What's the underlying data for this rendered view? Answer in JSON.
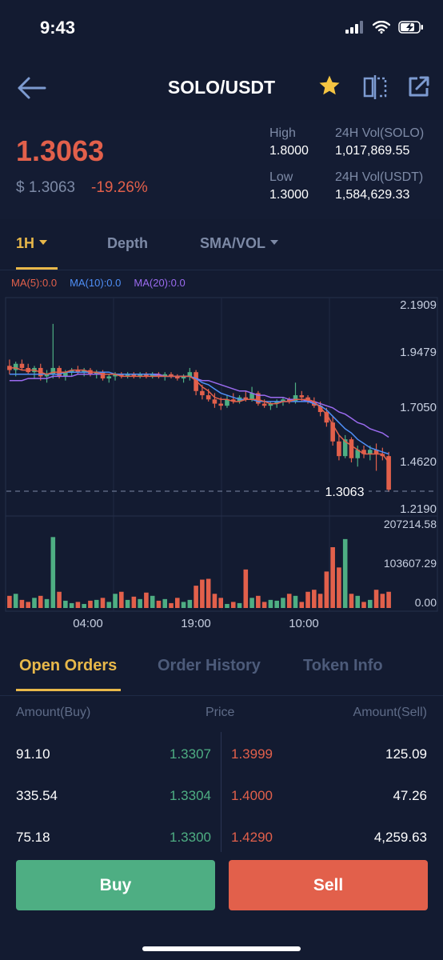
{
  "status_bar": {
    "time": "9:43"
  },
  "header": {
    "pair": "SOLO/USDT"
  },
  "price": {
    "last": "1.3063",
    "usd": "$ 1.3063",
    "change": "-19.26%",
    "high_label": "High",
    "high_value": "1.8000",
    "low_label": "Low",
    "low_value": "1.3000",
    "vol_base_label": "24H Vol(SOLO)",
    "vol_base_value": "1,017,869.55",
    "vol_quote_label": "24H Vol(USDT)",
    "vol_quote_value": "1,584,629.33"
  },
  "chart_tabs": {
    "interval": "1H",
    "depth": "Depth",
    "indicator": "SMA/VOL"
  },
  "ma_legend": {
    "ma5": "MA(5):0.0",
    "ma10": "MA(10):0.0",
    "ma20": "MA(20):0.0"
  },
  "colors": {
    "up": "#4eae83",
    "down": "#e2604b",
    "accent": "#e8b84a",
    "ma5": "#e2604b",
    "ma10": "#4f8ff7",
    "ma20": "#9b6bf0",
    "background": "#131b31"
  },
  "chart": {
    "price_ticks": [
      "2.1909",
      "1.9479",
      "1.7050",
      "1.4620",
      "1.2190"
    ],
    "volume_ticks": [
      "207214.58",
      "103607.29",
      "0.00"
    ],
    "time_ticks": [
      "04:00",
      "19:00",
      "10:00"
    ],
    "last_price_marker": "1.3063"
  },
  "chart_data": {
    "type": "candlestick",
    "ylim": [
      1.219,
      2.1909
    ],
    "volume_ylim": [
      0,
      207214.58
    ],
    "candles": [
      {
        "o": 1.9,
        "h": 1.93,
        "l": 1.86,
        "c": 1.88,
        "v": 30000
      },
      {
        "o": 1.88,
        "h": 1.92,
        "l": 1.85,
        "c": 1.91,
        "v": 35000
      },
      {
        "o": 1.91,
        "h": 1.93,
        "l": 1.88,
        "c": 1.89,
        "v": 20000
      },
      {
        "o": 1.89,
        "h": 1.91,
        "l": 1.86,
        "c": 1.87,
        "v": 15000
      },
      {
        "o": 1.87,
        "h": 1.9,
        "l": 1.84,
        "c": 1.89,
        "v": 25000
      },
      {
        "o": 1.89,
        "h": 1.91,
        "l": 1.83,
        "c": 1.85,
        "v": 30000
      },
      {
        "o": 1.85,
        "h": 1.88,
        "l": 1.82,
        "c": 1.86,
        "v": 22000
      },
      {
        "o": 1.86,
        "h": 2.1,
        "l": 1.84,
        "c": 1.89,
        "v": 175000
      },
      {
        "o": 1.89,
        "h": 1.9,
        "l": 1.84,
        "c": 1.85,
        "v": 40000
      },
      {
        "o": 1.85,
        "h": 1.88,
        "l": 1.83,
        "c": 1.87,
        "v": 18000
      },
      {
        "o": 1.87,
        "h": 1.89,
        "l": 1.85,
        "c": 1.88,
        "v": 12000
      },
      {
        "o": 1.88,
        "h": 1.9,
        "l": 1.86,
        "c": 1.87,
        "v": 15000
      },
      {
        "o": 1.87,
        "h": 1.89,
        "l": 1.85,
        "c": 1.88,
        "v": 10000
      },
      {
        "o": 1.88,
        "h": 1.89,
        "l": 1.85,
        "c": 1.86,
        "v": 18000
      },
      {
        "o": 1.86,
        "h": 1.88,
        "l": 1.84,
        "c": 1.87,
        "v": 20000
      },
      {
        "o": 1.87,
        "h": 1.88,
        "l": 1.83,
        "c": 1.84,
        "v": 25000
      },
      {
        "o": 1.84,
        "h": 1.86,
        "l": 1.82,
        "c": 1.85,
        "v": 15000
      },
      {
        "o": 1.85,
        "h": 1.87,
        "l": 1.83,
        "c": 1.86,
        "v": 35000
      },
      {
        "o": 1.86,
        "h": 1.87,
        "l": 1.84,
        "c": 1.85,
        "v": 40000
      },
      {
        "o": 1.85,
        "h": 1.87,
        "l": 1.84,
        "c": 1.86,
        "v": 20000
      },
      {
        "o": 1.86,
        "h": 1.87,
        "l": 1.84,
        "c": 1.85,
        "v": 28000
      },
      {
        "o": 1.85,
        "h": 1.87,
        "l": 1.84,
        "c": 1.86,
        "v": 22000
      },
      {
        "o": 1.86,
        "h": 1.87,
        "l": 1.84,
        "c": 1.85,
        "v": 38000
      },
      {
        "o": 1.85,
        "h": 1.87,
        "l": 1.84,
        "c": 1.86,
        "v": 30000
      },
      {
        "o": 1.86,
        "h": 1.87,
        "l": 1.84,
        "c": 1.85,
        "v": 18000
      },
      {
        "o": 1.85,
        "h": 1.87,
        "l": 1.83,
        "c": 1.86,
        "v": 22000
      },
      {
        "o": 1.86,
        "h": 1.87,
        "l": 1.84,
        "c": 1.85,
        "v": 12000
      },
      {
        "o": 1.85,
        "h": 1.86,
        "l": 1.83,
        "c": 1.84,
        "v": 25000
      },
      {
        "o": 1.84,
        "h": 1.86,
        "l": 1.82,
        "c": 1.85,
        "v": 15000
      },
      {
        "o": 1.85,
        "h": 1.89,
        "l": 1.83,
        "c": 1.87,
        "v": 20000
      },
      {
        "o": 1.87,
        "h": 1.88,
        "l": 1.76,
        "c": 1.78,
        "v": 55000
      },
      {
        "o": 1.78,
        "h": 1.81,
        "l": 1.74,
        "c": 1.76,
        "v": 70000
      },
      {
        "o": 1.76,
        "h": 1.79,
        "l": 1.73,
        "c": 1.74,
        "v": 72000
      },
      {
        "o": 1.74,
        "h": 1.77,
        "l": 1.7,
        "c": 1.72,
        "v": 35000
      },
      {
        "o": 1.72,
        "h": 1.75,
        "l": 1.69,
        "c": 1.71,
        "v": 25000
      },
      {
        "o": 1.71,
        "h": 1.76,
        "l": 1.7,
        "c": 1.74,
        "v": 10000
      },
      {
        "o": 1.74,
        "h": 1.77,
        "l": 1.72,
        "c": 1.73,
        "v": 15000
      },
      {
        "o": 1.73,
        "h": 1.76,
        "l": 1.72,
        "c": 1.75,
        "v": 12000
      },
      {
        "o": 1.75,
        "h": 1.78,
        "l": 1.73,
        "c": 1.74,
        "v": 95000
      },
      {
        "o": 1.74,
        "h": 1.8,
        "l": 1.73,
        "c": 1.77,
        "v": 25000
      },
      {
        "o": 1.77,
        "h": 1.78,
        "l": 1.71,
        "c": 1.72,
        "v": 30000
      },
      {
        "o": 1.72,
        "h": 1.74,
        "l": 1.7,
        "c": 1.71,
        "v": 15000
      },
      {
        "o": 1.71,
        "h": 1.73,
        "l": 1.69,
        "c": 1.72,
        "v": 20000
      },
      {
        "o": 1.72,
        "h": 1.74,
        "l": 1.7,
        "c": 1.73,
        "v": 18000
      },
      {
        "o": 1.73,
        "h": 1.75,
        "l": 1.71,
        "c": 1.74,
        "v": 25000
      },
      {
        "o": 1.74,
        "h": 1.75,
        "l": 1.72,
        "c": 1.73,
        "v": 35000
      },
      {
        "o": 1.73,
        "h": 1.82,
        "l": 1.72,
        "c": 1.76,
        "v": 30000
      },
      {
        "o": 1.76,
        "h": 1.78,
        "l": 1.73,
        "c": 1.75,
        "v": 15000
      },
      {
        "o": 1.75,
        "h": 1.76,
        "l": 1.72,
        "c": 1.73,
        "v": 40000
      },
      {
        "o": 1.73,
        "h": 1.75,
        "l": 1.7,
        "c": 1.71,
        "v": 45000
      },
      {
        "o": 1.71,
        "h": 1.73,
        "l": 1.66,
        "c": 1.68,
        "v": 35000
      },
      {
        "o": 1.68,
        "h": 1.7,
        "l": 1.61,
        "c": 1.63,
        "v": 90000
      },
      {
        "o": 1.63,
        "h": 1.66,
        "l": 1.52,
        "c": 1.54,
        "v": 150000
      },
      {
        "o": 1.54,
        "h": 1.57,
        "l": 1.45,
        "c": 1.47,
        "v": 100000
      },
      {
        "o": 1.47,
        "h": 1.57,
        "l": 1.46,
        "c": 1.55,
        "v": 170000
      },
      {
        "o": 1.55,
        "h": 1.56,
        "l": 1.44,
        "c": 1.46,
        "v": 35000
      },
      {
        "o": 1.46,
        "h": 1.52,
        "l": 1.42,
        "c": 1.5,
        "v": 30000
      },
      {
        "o": 1.5,
        "h": 1.52,
        "l": 1.46,
        "c": 1.48,
        "v": 15000
      },
      {
        "o": 1.48,
        "h": 1.52,
        "l": 1.45,
        "c": 1.5,
        "v": 20000
      },
      {
        "o": 1.5,
        "h": 1.53,
        "l": 1.4,
        "c": 1.48,
        "v": 45000
      },
      {
        "o": 1.48,
        "h": 1.51,
        "l": 1.45,
        "c": 1.47,
        "v": 35000
      },
      {
        "o": 1.47,
        "h": 1.49,
        "l": 1.3,
        "c": 1.31,
        "v": 40000
      }
    ],
    "ma5": [
      1.89,
      1.89,
      1.88,
      1.88,
      1.88,
      1.87,
      1.86,
      1.87,
      1.87,
      1.87,
      1.88,
      1.88,
      1.88,
      1.87,
      1.87,
      1.86,
      1.86,
      1.86,
      1.85,
      1.85,
      1.85,
      1.85,
      1.85,
      1.85,
      1.85,
      1.85,
      1.85,
      1.85,
      1.85,
      1.85,
      1.83,
      1.8,
      1.78,
      1.75,
      1.74,
      1.74,
      1.73,
      1.73,
      1.74,
      1.74,
      1.74,
      1.73,
      1.72,
      1.72,
      1.73,
      1.73,
      1.74,
      1.74,
      1.74,
      1.73,
      1.7,
      1.67,
      1.62,
      1.57,
      1.54,
      1.52,
      1.5,
      1.48,
      1.48,
      1.48,
      1.48,
      1.44
    ],
    "ma10": [
      1.86,
      1.86,
      1.86,
      1.86,
      1.86,
      1.86,
      1.86,
      1.86,
      1.86,
      1.87,
      1.87,
      1.87,
      1.87,
      1.87,
      1.87,
      1.87,
      1.87,
      1.86,
      1.86,
      1.86,
      1.86,
      1.86,
      1.86,
      1.86,
      1.85,
      1.85,
      1.85,
      1.85,
      1.85,
      1.85,
      1.84,
      1.82,
      1.81,
      1.79,
      1.77,
      1.76,
      1.75,
      1.74,
      1.74,
      1.74,
      1.73,
      1.73,
      1.73,
      1.73,
      1.73,
      1.73,
      1.73,
      1.73,
      1.73,
      1.72,
      1.71,
      1.69,
      1.66,
      1.63,
      1.6,
      1.58,
      1.55,
      1.53,
      1.51,
      1.5,
      1.49,
      1.48
    ],
    "ma20": [
      1.83,
      1.83,
      1.83,
      1.84,
      1.84,
      1.84,
      1.84,
      1.85,
      1.85,
      1.85,
      1.85,
      1.86,
      1.86,
      1.86,
      1.86,
      1.86,
      1.86,
      1.86,
      1.86,
      1.86,
      1.86,
      1.86,
      1.86,
      1.86,
      1.86,
      1.85,
      1.85,
      1.85,
      1.85,
      1.85,
      1.84,
      1.83,
      1.83,
      1.82,
      1.81,
      1.8,
      1.79,
      1.78,
      1.78,
      1.77,
      1.76,
      1.76,
      1.75,
      1.75,
      1.75,
      1.74,
      1.74,
      1.74,
      1.73,
      1.73,
      1.72,
      1.71,
      1.7,
      1.68,
      1.67,
      1.65,
      1.63,
      1.62,
      1.6,
      1.59,
      1.58,
      1.56
    ]
  },
  "bottom_tabs": {
    "open_orders": "Open Orders",
    "order_history": "Order History",
    "token_info": "Token Info"
  },
  "order_book": {
    "headers": {
      "amount_buy": "Amount(Buy)",
      "price": "Price",
      "amount_sell": "Amount(Sell)"
    },
    "rows": [
      {
        "buy_amount": "91.10",
        "buy_price": "1.3307",
        "sell_price": "1.3999",
        "sell_amount": "125.09"
      },
      {
        "buy_amount": "335.54",
        "buy_price": "1.3304",
        "sell_price": "1.4000",
        "sell_amount": "47.26"
      },
      {
        "buy_amount": "75.18",
        "buy_price": "1.3300",
        "sell_price": "1.4290",
        "sell_amount": "4,259.63"
      }
    ]
  },
  "actions": {
    "buy": "Buy",
    "sell": "Sell"
  }
}
